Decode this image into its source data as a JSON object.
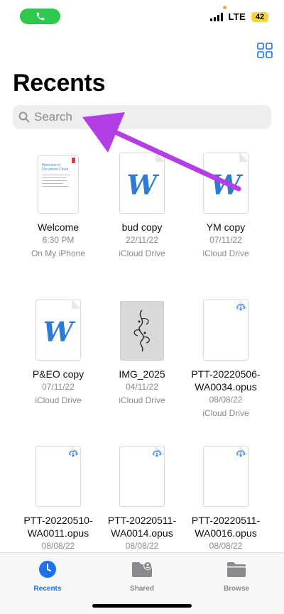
{
  "status_bar": {
    "network": "LTE",
    "battery": "42"
  },
  "header": {
    "title": "Recents"
  },
  "search": {
    "placeholder": "Search"
  },
  "files": [
    {
      "name": "Welcome",
      "date": "6:30 PM",
      "location": "On My iPhone",
      "kind": "welcome-pdf"
    },
    {
      "name": "bud copy",
      "date": "22/11/22",
      "location": "iCloud Drive",
      "kind": "word"
    },
    {
      "name": "YM copy",
      "date": "07/11/22",
      "location": "iCloud Drive",
      "kind": "word"
    },
    {
      "name": "P&EO copy",
      "date": "07/11/22",
      "location": "iCloud Drive",
      "kind": "word"
    },
    {
      "name": "IMG_2025",
      "date": "04/11/22",
      "location": "iCloud Drive",
      "kind": "image"
    },
    {
      "name_line1": "PTT-20220506-",
      "name_line2": "WA0034.opus",
      "date": "08/08/22",
      "location": "iCloud Drive",
      "kind": "cloud"
    },
    {
      "name_line1": "PTT-20220510-",
      "name_line2": "WA0011.opus",
      "date": "08/08/22",
      "kind": "cloud"
    },
    {
      "name_line1": "PTT-20220511-",
      "name_line2": "WA0014.opus",
      "date": "08/08/22",
      "kind": "cloud"
    },
    {
      "name_line1": "PTT-20220511-",
      "name_line2": "WA0016.opus",
      "date": "08/08/22",
      "kind": "cloud"
    }
  ],
  "welcome_thumb": {
    "title_line1": "Welcome to",
    "title_line2": "Document Cloud"
  },
  "tabs": [
    {
      "label": "Recents",
      "icon": "clock-icon",
      "active": true
    },
    {
      "label": "Shared",
      "icon": "shared-folder-icon",
      "active": false
    },
    {
      "label": "Browse",
      "icon": "folder-icon",
      "active": false
    }
  ],
  "colors": {
    "accent": "#1a73e8",
    "call_pill": "#2fc84f",
    "battery": "#f7d53b",
    "arrow": "#b33ee6",
    "word_blue": "#2e7bd6"
  }
}
